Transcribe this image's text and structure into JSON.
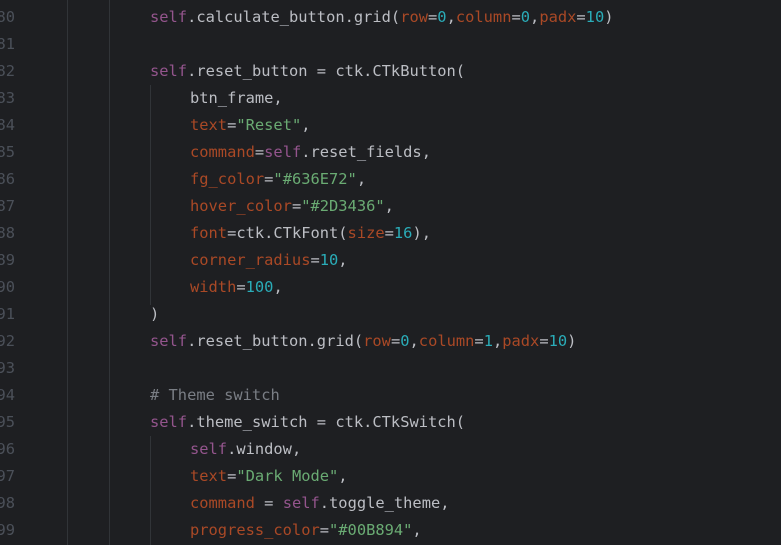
{
  "theme": {
    "background": "#1e1f22",
    "line_number": "#4b5059",
    "self": "#94558d",
    "keyword_arg": "#aa4926",
    "string": "#6aab73",
    "number": "#2aacb8",
    "plain": "#bcbec4",
    "comment": "#7a7e85"
  },
  "lines": [
    {
      "num": "80",
      "indent": 1,
      "tokens": [
        {
          "t": "self",
          "c": "self"
        },
        {
          "t": ".calculate_button.grid(",
          "c": "plain"
        },
        {
          "t": "row",
          "c": "arg"
        },
        {
          "t": "=",
          "c": "plain"
        },
        {
          "t": "0",
          "c": "num"
        },
        {
          "t": ",",
          "c": "plain"
        },
        {
          "t": "column",
          "c": "arg"
        },
        {
          "t": "=",
          "c": "plain"
        },
        {
          "t": "0",
          "c": "num"
        },
        {
          "t": ",",
          "c": "plain"
        },
        {
          "t": "padx",
          "c": "arg"
        },
        {
          "t": "=",
          "c": "plain"
        },
        {
          "t": "10",
          "c": "num"
        },
        {
          "t": ")",
          "c": "plain"
        }
      ]
    },
    {
      "num": "81",
      "indent": 1,
      "tokens": []
    },
    {
      "num": "82",
      "indent": 1,
      "tokens": [
        {
          "t": "self",
          "c": "self"
        },
        {
          "t": ".reset_button = ctk.CTkButton(",
          "c": "plain"
        }
      ]
    },
    {
      "num": "83",
      "indent": 2,
      "tokens": [
        {
          "t": "btn_frame,",
          "c": "plain"
        }
      ]
    },
    {
      "num": "84",
      "indent": 2,
      "tokens": [
        {
          "t": "text",
          "c": "arg"
        },
        {
          "t": "=",
          "c": "plain"
        },
        {
          "t": "\"Reset\"",
          "c": "str"
        },
        {
          "t": ",",
          "c": "plain"
        }
      ]
    },
    {
      "num": "85",
      "indent": 2,
      "tokens": [
        {
          "t": "command",
          "c": "arg"
        },
        {
          "t": "=",
          "c": "plain"
        },
        {
          "t": "self",
          "c": "self"
        },
        {
          "t": ".reset_fields,",
          "c": "plain"
        }
      ]
    },
    {
      "num": "86",
      "indent": 2,
      "tokens": [
        {
          "t": "fg_color",
          "c": "arg"
        },
        {
          "t": "=",
          "c": "plain"
        },
        {
          "t": "\"#636E72\"",
          "c": "str"
        },
        {
          "t": ",",
          "c": "plain"
        }
      ]
    },
    {
      "num": "87",
      "indent": 2,
      "tokens": [
        {
          "t": "hover_color",
          "c": "arg"
        },
        {
          "t": "=",
          "c": "plain"
        },
        {
          "t": "\"#2D3436\"",
          "c": "str"
        },
        {
          "t": ",",
          "c": "plain"
        }
      ]
    },
    {
      "num": "88",
      "indent": 2,
      "tokens": [
        {
          "t": "font",
          "c": "arg"
        },
        {
          "t": "=ctk.CTkFont(",
          "c": "plain"
        },
        {
          "t": "size",
          "c": "arg"
        },
        {
          "t": "=",
          "c": "plain"
        },
        {
          "t": "16",
          "c": "num"
        },
        {
          "t": "),",
          "c": "plain"
        }
      ]
    },
    {
      "num": "89",
      "indent": 2,
      "tokens": [
        {
          "t": "corner_radius",
          "c": "arg"
        },
        {
          "t": "=",
          "c": "plain"
        },
        {
          "t": "10",
          "c": "num"
        },
        {
          "t": ",",
          "c": "plain"
        }
      ]
    },
    {
      "num": "90",
      "indent": 2,
      "tokens": [
        {
          "t": "width",
          "c": "arg"
        },
        {
          "t": "=",
          "c": "plain"
        },
        {
          "t": "100",
          "c": "num"
        },
        {
          "t": ",",
          "c": "plain"
        }
      ]
    },
    {
      "num": "91",
      "indent": 1,
      "tokens": [
        {
          "t": ")",
          "c": "plain"
        }
      ]
    },
    {
      "num": "92",
      "indent": 1,
      "tokens": [
        {
          "t": "self",
          "c": "self"
        },
        {
          "t": ".reset_button.grid(",
          "c": "plain"
        },
        {
          "t": "row",
          "c": "arg"
        },
        {
          "t": "=",
          "c": "plain"
        },
        {
          "t": "0",
          "c": "num"
        },
        {
          "t": ",",
          "c": "plain"
        },
        {
          "t": "column",
          "c": "arg"
        },
        {
          "t": "=",
          "c": "plain"
        },
        {
          "t": "1",
          "c": "num"
        },
        {
          "t": ",",
          "c": "plain"
        },
        {
          "t": "padx",
          "c": "arg"
        },
        {
          "t": "=",
          "c": "plain"
        },
        {
          "t": "10",
          "c": "num"
        },
        {
          "t": ")",
          "c": "plain"
        }
      ]
    },
    {
      "num": "93",
      "indent": 1,
      "tokens": []
    },
    {
      "num": "94",
      "indent": 1,
      "tokens": [
        {
          "t": "# Theme switch",
          "c": "cmt"
        }
      ]
    },
    {
      "num": "95",
      "indent": 1,
      "tokens": [
        {
          "t": "self",
          "c": "self"
        },
        {
          "t": ".theme_switch = ctk.CTkSwitch(",
          "c": "plain"
        }
      ]
    },
    {
      "num": "96",
      "indent": 2,
      "tokens": [
        {
          "t": "self",
          "c": "self"
        },
        {
          "t": ".window,",
          "c": "plain"
        }
      ]
    },
    {
      "num": "97",
      "indent": 2,
      "tokens": [
        {
          "t": "text",
          "c": "arg"
        },
        {
          "t": "=",
          "c": "plain"
        },
        {
          "t": "\"Dark Mode\"",
          "c": "str"
        },
        {
          "t": ",",
          "c": "plain"
        }
      ]
    },
    {
      "num": "98",
      "indent": 2,
      "tokens": [
        {
          "t": "command",
          "c": "arg"
        },
        {
          "t": " = ",
          "c": "plain"
        },
        {
          "t": "self",
          "c": "self"
        },
        {
          "t": ".toggle_theme,",
          "c": "plain"
        }
      ]
    },
    {
      "num": "99",
      "indent": 2,
      "tokens": [
        {
          "t": "progress_color",
          "c": "arg"
        },
        {
          "t": "=",
          "c": "plain"
        },
        {
          "t": "\"#00B894\"",
          "c": "str"
        },
        {
          "t": ",",
          "c": "plain"
        }
      ]
    }
  ]
}
